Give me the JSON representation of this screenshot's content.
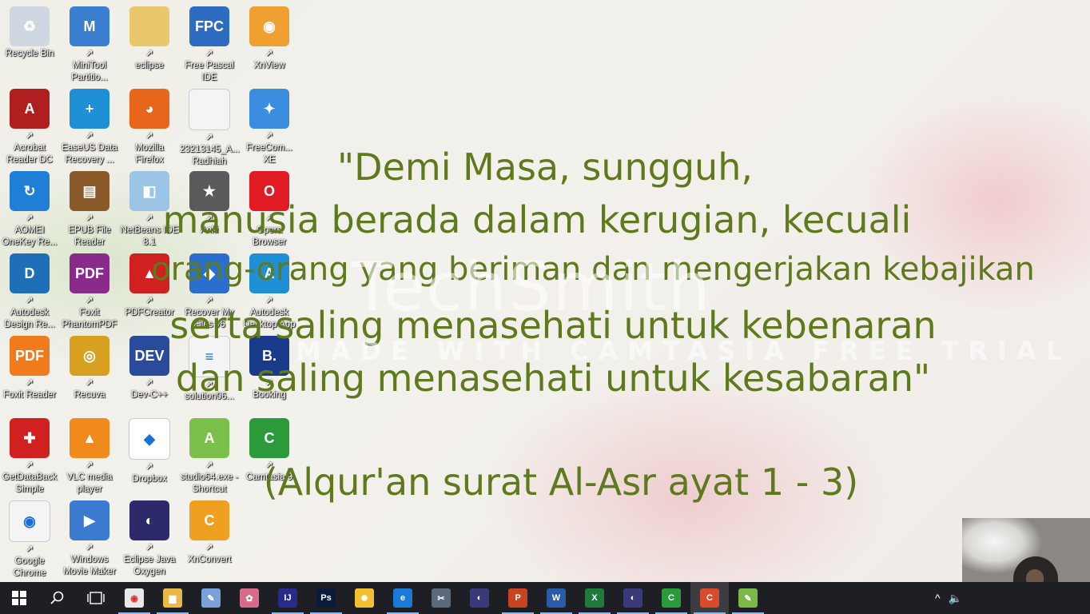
{
  "desktop": {
    "icons": [
      {
        "label": "Recycle Bin",
        "color": "#cfd8e0",
        "glyph": "♻"
      },
      {
        "label": "MiniTool Partitio...",
        "color": "#3a7fd0",
        "glyph": "M"
      },
      {
        "label": "eclipse",
        "color": "#e8c86a",
        "glyph": ""
      },
      {
        "label": "Free Pascal IDE",
        "color": "#2d6cc0",
        "glyph": "FPC"
      },
      {
        "label": "XnView",
        "color": "#f0a030",
        "glyph": "◉"
      },
      {
        "label": "Acrobat Reader DC",
        "color": "#b01f1f",
        "glyph": "A"
      },
      {
        "label": "EaseUS Data Recovery ...",
        "color": "#1f8fd6",
        "glyph": "+"
      },
      {
        "label": "Mozilla Firefox",
        "color": "#e8661c",
        "glyph": "◕"
      },
      {
        "label": "23213145_A... Radhiah",
        "color": "#f4f4f4",
        "glyph": ""
      },
      {
        "label": "FreeCom... XE",
        "color": "#3b8de0",
        "glyph": "✦"
      },
      {
        "label": "AOMEI OneKey Re...",
        "color": "#1f7fd6",
        "glyph": "↻"
      },
      {
        "label": "EPUB File Reader",
        "color": "#8a5a2a",
        "glyph": "▤"
      },
      {
        "label": "NetBeans IDE 8.1",
        "color": "#9cc4e4",
        "glyph": "◧"
      },
      {
        "label": "Anki",
        "color": "#5a5a5a",
        "glyph": "★"
      },
      {
        "label": "Opera Browser",
        "color": "#e01b24",
        "glyph": "O"
      },
      {
        "label": "Autodesk Design Re...",
        "color": "#1f6fb8",
        "glyph": "D"
      },
      {
        "label": "Foxit PhantomPDF",
        "color": "#8a2a8a",
        "glyph": "PDF"
      },
      {
        "label": "PDFCreator",
        "color": "#d02020",
        "glyph": "▲"
      },
      {
        "label": "Recover My Files v6",
        "color": "#2a6fd0",
        "glyph": "◆"
      },
      {
        "label": "Autodesk Desktop App",
        "color": "#1f8fd6",
        "glyph": "A"
      },
      {
        "label": "Foxit Reader",
        "color": "#f07a1c",
        "glyph": "PDF"
      },
      {
        "label": "Recuva",
        "color": "#d8a020",
        "glyph": "◎"
      },
      {
        "label": "Dev-C++",
        "color": "#2a4a9a",
        "glyph": "DEV"
      },
      {
        "label": "solution06...",
        "color": "#f4f4f4",
        "glyph": "≡"
      },
      {
        "label": "Booking",
        "color": "#1a3a8a",
        "glyph": "B."
      },
      {
        "label": "GetDataBack Simple",
        "color": "#d02020",
        "glyph": "✚"
      },
      {
        "label": "VLC media player",
        "color": "#f08a1c",
        "glyph": "▲"
      },
      {
        "label": "Dropbox",
        "color": "#ffffff",
        "glyph": "◆"
      },
      {
        "label": "studio64.exe - Shortcut",
        "color": "#7ac04a",
        "glyph": "A"
      },
      {
        "label": "Camtasia 9",
        "color": "#2a9a3a",
        "glyph": "C"
      },
      {
        "label": "Google Chrome",
        "color": "#f4f4f4",
        "glyph": "◉"
      },
      {
        "label": "Windows Movie Maker",
        "color": "#3a7ad0",
        "glyph": "▶"
      },
      {
        "label": "Eclipse Java Oxygen",
        "color": "#2c2a6a",
        "glyph": "◐"
      },
      {
        "label": "XnConvert",
        "color": "#f0a020",
        "glyph": "C"
      }
    ]
  },
  "wallpaper": {
    "quote_lines": [
      "\"Demi Masa, sungguh,",
      "manusia berada dalam kerugian, kecuali",
      "orang-orang yang beriman dan mengerjakan kebajikan",
      "serta saling menasehati untuk kebenaran",
      "dan saling menasehati untuk kesabaran\""
    ],
    "source": "(Alqur'an surat Al-Asr ayat 1 - 3)"
  },
  "watermark": {
    "brand": "TechSmith",
    "trial": "MADE WITH CAMTASIA FREE TRIAL"
  },
  "taskbar": {
    "start_icon": "windows-logo",
    "search_icon": "search",
    "task_view_icon": "task-view",
    "apps": [
      {
        "name": "chrome",
        "label": "◉",
        "color": "#e8e8e8"
      },
      {
        "name": "file-explorer",
        "label": "▆",
        "color": "#e8b84a"
      },
      {
        "name": "paint",
        "label": "✎",
        "color": "#7aa0d8"
      },
      {
        "name": "paint-3d",
        "label": "✿",
        "color": "#d86a8a"
      },
      {
        "name": "intellij",
        "label": "IJ",
        "color": "#2a2a8a"
      },
      {
        "name": "photoshop",
        "label": "Ps",
        "color": "#0a1a3a"
      },
      {
        "name": "tips",
        "label": "✹",
        "color": "#f0c030"
      },
      {
        "name": "edge",
        "label": "e",
        "color": "#1a7ad8"
      },
      {
        "name": "snipping",
        "label": "✂",
        "color": "#5a6a7a"
      },
      {
        "name": "eclipse",
        "label": "◐",
        "color": "#3a3a7a"
      },
      {
        "name": "powerpoint",
        "label": "P",
        "color": "#c8431f"
      },
      {
        "name": "word",
        "label": "W",
        "color": "#2a5aa8"
      },
      {
        "name": "excel",
        "label": "X",
        "color": "#1f7a3a"
      },
      {
        "name": "eclipse-2",
        "label": "◐",
        "color": "#3a3a7a"
      },
      {
        "name": "camtasia",
        "label": "C",
        "color": "#2a9a3a"
      },
      {
        "name": "camtasia-recorder",
        "label": "C",
        "color": "#d84a2a"
      },
      {
        "name": "notepad-plus",
        "label": "✎",
        "color": "#7ab84a"
      }
    ],
    "tray": {
      "chevron": "^",
      "volume": "🔈"
    }
  }
}
